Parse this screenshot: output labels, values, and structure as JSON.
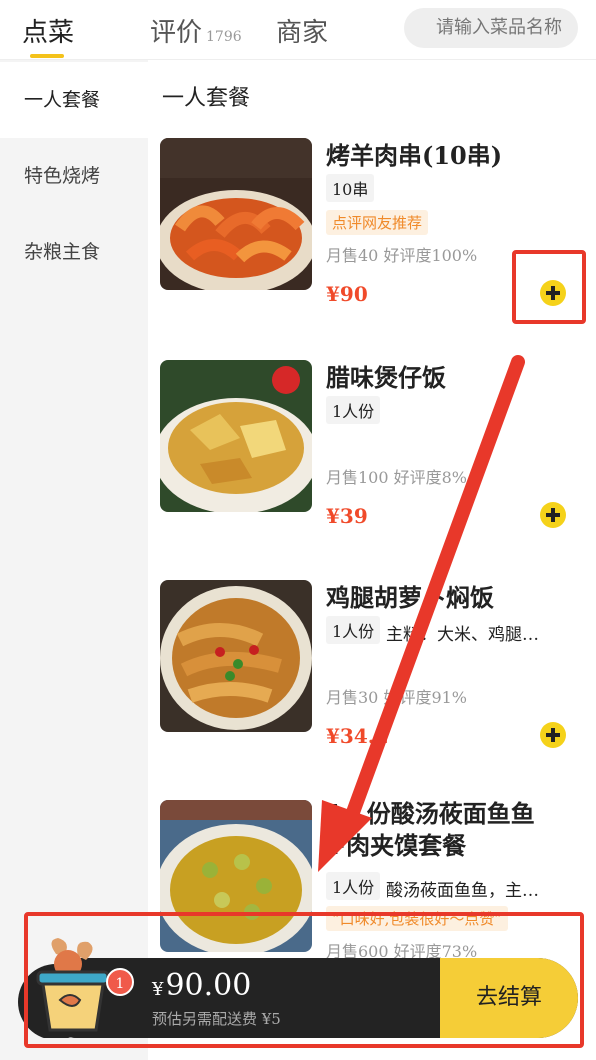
{
  "tabs": {
    "order": "点菜",
    "reviews": "评价",
    "reviews_count": "1796",
    "merchant": "商家"
  },
  "search": {
    "placeholder": "请输入菜品名称"
  },
  "sidebar": {
    "items": [
      {
        "label": "一人套餐"
      },
      {
        "label": "特色烧烤"
      },
      {
        "label": "杂粮主食"
      }
    ]
  },
  "main": {
    "section_title": "一人套餐",
    "dishes": [
      {
        "name": "烤羊肉串(10串)",
        "tag": "10串",
        "desc": "",
        "recommend": "点评网友推荐",
        "stats": "月售40  好评度100%",
        "price": "¥90"
      },
      {
        "name": "腊味煲仔饭",
        "tag": "1人份",
        "desc": "",
        "recommend": "",
        "stats": "月售100  好评度8%",
        "price": "¥39"
      },
      {
        "name": "鸡腿胡萝卜焖饭",
        "tag": "1人份",
        "desc": "主料：大米、鸡腿…",
        "recommend": "",
        "stats": "月售30  好评度91%",
        "price": "¥34.2"
      },
      {
        "name": "1人份酸汤莜面鱼鱼+肉夹馍套餐",
        "tag": "1人份",
        "desc": "酸汤莜面鱼鱼，主…",
        "recommend": "“口味好,包装很好～点赞”",
        "stats": "月售600  好评度73%",
        "price": ""
      }
    ]
  },
  "cart": {
    "badge": "1",
    "total": "90.00",
    "currency": "¥",
    "delivery_note": "预估另需配送费 ¥5",
    "checkout_label": "去结算"
  },
  "colors": {
    "accent": "#f5cd37",
    "price": "#f04a2a",
    "annotation": "#e8382a"
  }
}
